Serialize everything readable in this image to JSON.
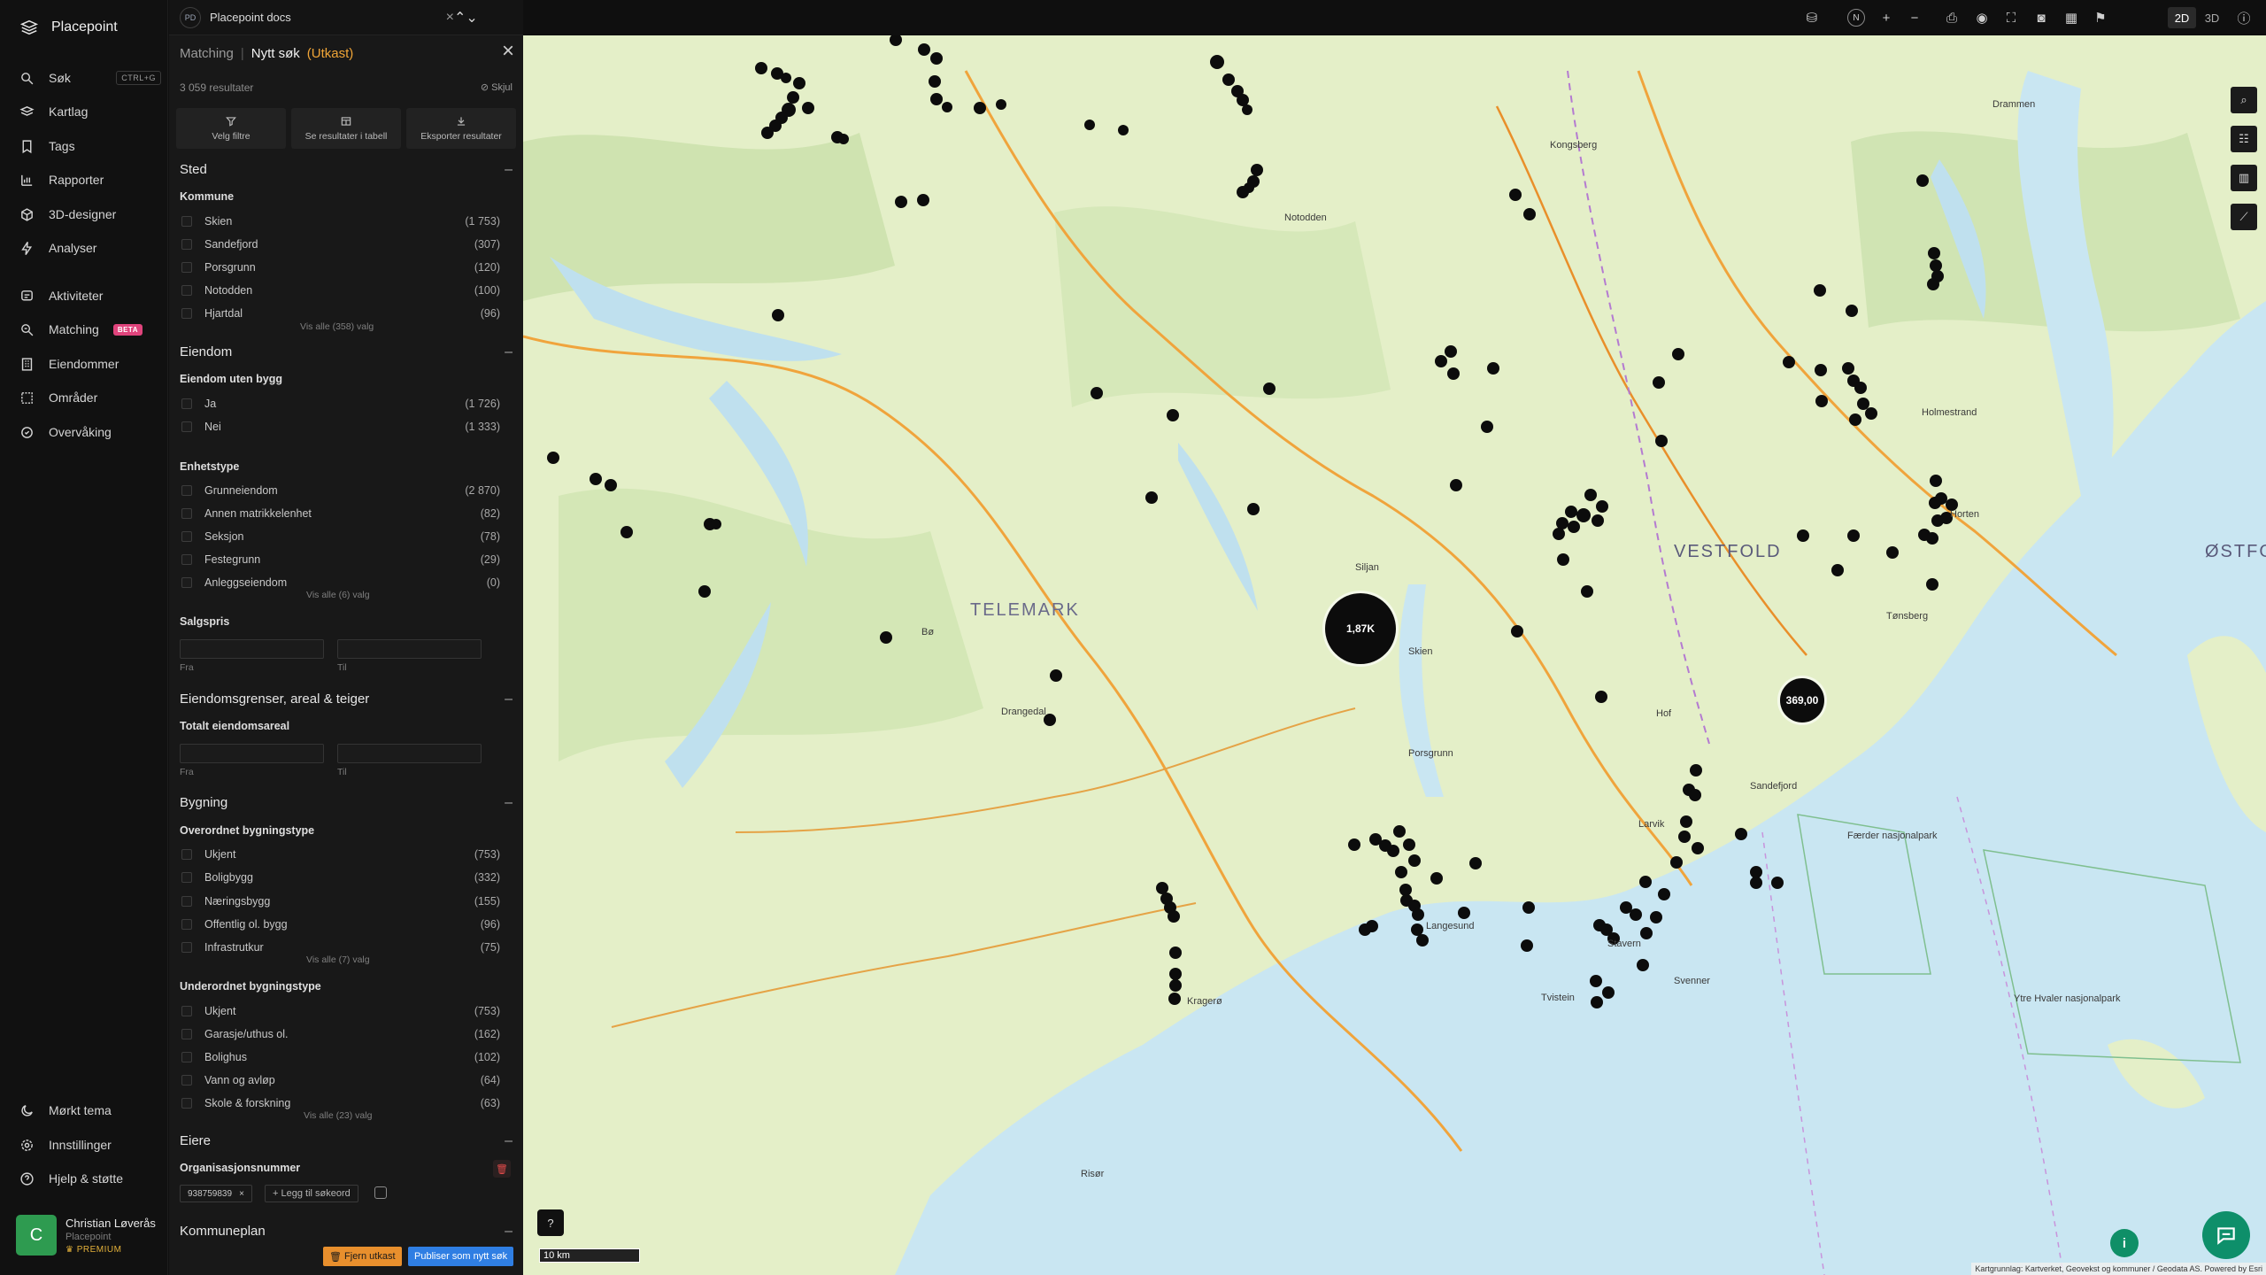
{
  "nav": {
    "brand": "Placepoint",
    "items": [
      {
        "label": "Søk",
        "shortcut": "CTRL+G"
      },
      {
        "label": "Kartlag"
      },
      {
        "label": "Tags"
      },
      {
        "label": "Rapporter"
      },
      {
        "label": "3D-designer"
      },
      {
        "label": "Analyser"
      },
      {
        "label": "Aktiviteter"
      },
      {
        "label": "Matching",
        "badge": "BETA"
      },
      {
        "label": "Eiendommer"
      },
      {
        "label": "Områder"
      },
      {
        "label": "Overvåking"
      }
    ],
    "bottom": [
      {
        "label": "Mørkt tema"
      },
      {
        "label": "Innstillinger"
      },
      {
        "label": "Hjelp & støtte"
      }
    ],
    "user": {
      "initial": "C",
      "name": "Christian Løverås",
      "org": "Placepoint",
      "plan": "PREMIUM"
    }
  },
  "tab": {
    "initials": "PD",
    "title": "Placepoint docs"
  },
  "panel": {
    "crumb_parent": "Matching",
    "crumb_sep": "|",
    "crumb_title": "Nytt søk",
    "crumb_status": "(Utkast)",
    "results": "3 059 resultater",
    "hide": "Skjul",
    "actions": [
      "Velg filtre",
      "Se resultater i tabell",
      "Eksporter resultater"
    ],
    "sections": {
      "sted": {
        "title": "Sted",
        "sub": "Kommune",
        "options": [
          {
            "label": "Skien",
            "count": "(1 753)"
          },
          {
            "label": "Sandefjord",
            "count": "(307)"
          },
          {
            "label": "Porsgrunn",
            "count": "(120)"
          },
          {
            "label": "Notodden",
            "count": "(100)"
          },
          {
            "label": "Hjartdal",
            "count": "(96)"
          }
        ],
        "more": "Vis alle (358) valg"
      },
      "eiendom": {
        "title": "Eiendom",
        "sub1": "Eiendom uten bygg",
        "options1": [
          {
            "label": "Ja",
            "count": "(1 726)"
          },
          {
            "label": "Nei",
            "count": "(1 333)"
          }
        ],
        "sub2": "Enhetstype",
        "options2": [
          {
            "label": "Grunneiendom",
            "count": "(2 870)"
          },
          {
            "label": "Annen matrikkelenhet",
            "count": "(82)"
          },
          {
            "label": "Seksjon",
            "count": "(78)"
          },
          {
            "label": "Festegrunn",
            "count": "(29)"
          },
          {
            "label": "Anleggseiendom",
            "count": "(0)"
          }
        ],
        "more": "Vis alle (6) valg",
        "sub3": "Salgspris",
        "from": "Fra",
        "to": "Til"
      },
      "areal": {
        "title": "Eiendomsgrenser, areal & teiger",
        "sub": "Totalt eiendomsareal",
        "from": "Fra",
        "to": "Til"
      },
      "bygning": {
        "title": "Bygning",
        "sub1": "Overordnet bygningstype",
        "options1": [
          {
            "label": "Ukjent",
            "count": "(753)"
          },
          {
            "label": "Boligbygg",
            "count": "(332)"
          },
          {
            "label": "Næringsbygg",
            "count": "(155)"
          },
          {
            "label": "Offentlig ol. bygg",
            "count": "(96)"
          },
          {
            "label": "Infrastrutkur",
            "count": "(75)"
          }
        ],
        "more1": "Vis alle (7) valg",
        "sub2": "Underordnet bygningstype",
        "options2": [
          {
            "label": "Ukjent",
            "count": "(753)"
          },
          {
            "label": "Garasje/uthus ol.",
            "count": "(162)"
          },
          {
            "label": "Bolighus",
            "count": "(102)"
          },
          {
            "label": "Vann og avløp",
            "count": "(64)"
          },
          {
            "label": "Skole & forskning",
            "count": "(63)"
          }
        ],
        "more2": "Vis alle (23) valg"
      },
      "eiere": {
        "title": "Eiere",
        "sub": "Organisasjonsnummer",
        "chip": "938759839",
        "add": "+ Legg til søkeord"
      },
      "kommuneplan": {
        "title": "Kommuneplan"
      }
    },
    "btn_remove": "Fjern utkast",
    "btn_publish": "Publiser som nytt søk"
  },
  "toolbar": {
    "mode_2d": "2D",
    "mode_3d": "3D",
    "compass": "N"
  },
  "map": {
    "region_labels": [
      "TELEMARK",
      "VESTFOLD",
      "ØSTFO"
    ],
    "place_labels": [
      {
        "t": "Skien"
      },
      {
        "t": "Porsgrunn"
      },
      {
        "t": "Sandefjord"
      },
      {
        "t": "Larvik"
      },
      {
        "t": "Tønsberg"
      },
      {
        "t": "Kragerø"
      },
      {
        "t": "Drammen"
      },
      {
        "t": "Kongsberg"
      },
      {
        "t": "Notodden"
      },
      {
        "t": "Bø"
      },
      {
        "t": "Horten"
      },
      {
        "t": "Holmestrand"
      },
      {
        "t": "Stavern"
      },
      {
        "t": "Langesund"
      },
      {
        "t": "Svenner"
      },
      {
        "t": "Tvistein"
      },
      {
        "t": "Færder nasjonalpark"
      },
      {
        "t": "Ytre Hvaler nasjonalpark"
      },
      {
        "t": "Risør"
      },
      {
        "t": "Drangedal"
      },
      {
        "t": "Siljan"
      },
      {
        "t": "Hof"
      }
    ],
    "clusters": [
      {
        "label": "1,87K"
      },
      {
        "label": "369,00"
      }
    ],
    "scale": "10 km",
    "attribution": "Kartgrunnlag: Kartverket, Geovekst og kommuner / Geodata AS. Powered by Esri",
    "colors": {
      "land": "#e4efc8",
      "water": "#c9e6f2",
      "dots": "#0c0c0c",
      "roads": "#f0a43c"
    }
  }
}
